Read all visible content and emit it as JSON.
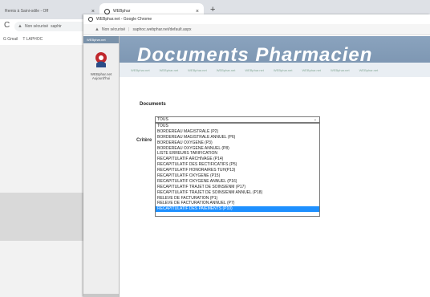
{
  "outer": {
    "tabs": [
      {
        "label": "Remis à Saini-odile - Off"
      },
      {
        "label": "WEBphar"
      }
    ],
    "new_tab": "+",
    "address_warning": "Non sécurisé",
    "address": "saphir",
    "bookmarks": [
      {
        "label": "G Gmail"
      },
      {
        "label": "T LAPHOC"
      }
    ]
  },
  "inner": {
    "title": "WEBphar.net - Google Chrome",
    "address_warning": "Non sécurisé",
    "address": "saphoc.webphar.net/default.aspx",
    "left_header": "WEBphar.net",
    "left_label_line1": "WEBphar.net",
    "left_label_line2": "Aujourd'hui",
    "banner_title": "Documents Pharmacien",
    "nav_links": [
      "WEBphar.net",
      "WEBphar.net",
      "WEBphar.net",
      "WEBphar.net",
      "WEBphar.net",
      "WEBphar.net",
      "WEBphar.net",
      "WEBphar.net",
      "WEBphar.net"
    ],
    "section_title": "Documents",
    "criteria_label": "Critère",
    "select_value": "TOUS",
    "options": [
      "TOUS",
      "BORDEREAU MAGISTRALE (P2)",
      "BORDEREAU MAGISTRALE ANNUEL (P6)",
      "BORDEREAU OXYGENE (P3)",
      "BORDEREAU OXYGENE ANNUEL (P8)",
      "LISTE ERREURS TARIFICATION",
      "RECAPITULATIF ARCHIVAGE (P14)",
      "RECAPITULATIF DES RECTIFICATIFS (P5)",
      "RECAPITULATIF HONORAIRES TUH(P13)",
      "RECAPITULATIF OXYGENE (P15)",
      "RECAPITULATIF OXYGENE ANNUEL (P16)",
      "RECAPITULATIF TRAJET DE SOINS/ENM (P17)",
      "RECAPITULATIF TRAJET DE SOINS/ENM ANNUEL (P18)",
      "RELEVE DE FACTURATION (P1)",
      "RELEVE DE FACTURATION ANNUEL (P7)",
      "RECAPITULATIF DES PAIEMENTS (P10)"
    ],
    "selected_index": 15
  },
  "colors": {
    "banner": "#7f97b3",
    "selected_option": "#1e90ff"
  }
}
